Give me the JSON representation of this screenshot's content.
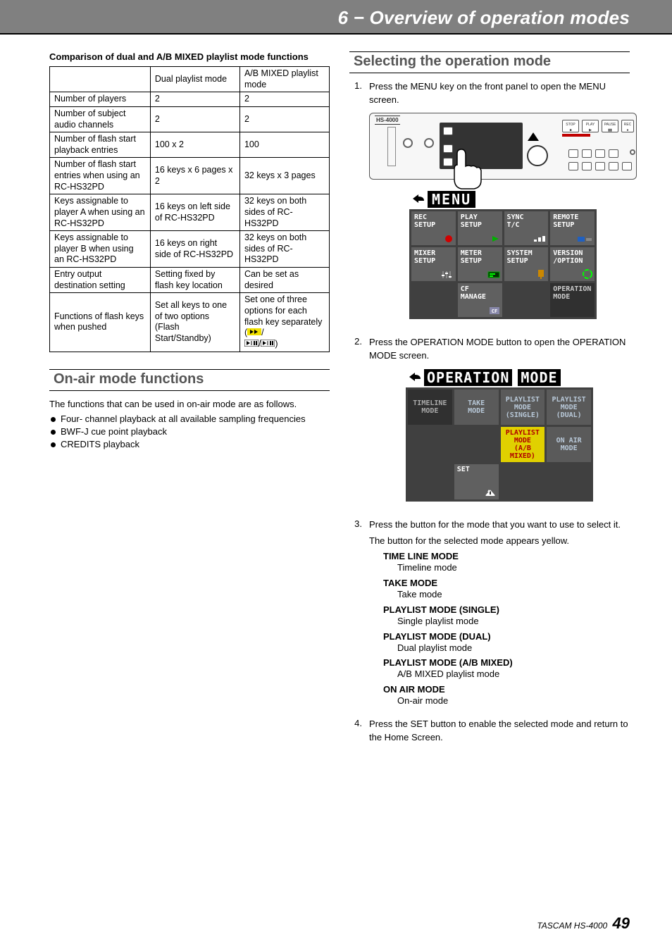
{
  "header": {
    "title": "6 − Overview of operation modes"
  },
  "left": {
    "comparison_title": "Comparison of dual and A/B MIXED playlist mode functions",
    "table": {
      "cols": [
        "",
        "Dual playlist mode",
        "A/B MIXED playlist mode"
      ],
      "rows": [
        [
          "Number of players",
          "2",
          "2"
        ],
        [
          "Number of subject audio channels",
          "2",
          "2"
        ],
        [
          "Number of flash start playback entries",
          "100 x 2",
          "100"
        ],
        [
          "Number of flash start entries when using an RC-HS32PD",
          "16 keys x 6 pages x 2",
          "32 keys x 3 pages"
        ],
        [
          "Keys assignable to player A when using an RC-HS32PD",
          "16 keys on left side of RC-HS32PD",
          "32 keys on both sides of RC-HS32PD"
        ],
        [
          "Keys assignable to player B when using an RC-HS32PD",
          "16 keys on right side of RC-HS32PD",
          "32 keys on both sides of RC-HS32PD"
        ],
        [
          "Entry output destination setting",
          "Setting fixed by flash key location",
          "Can be set as desired"
        ],
        [
          "Functions of flash keys when pushed",
          "Set all keys to one of two options (Flash Start/Standby)",
          "Set one of three options for each flash key separately"
        ]
      ]
    },
    "onair_title": "On-air mode functions",
    "onair_intro": "The functions that can be used in on-air mode are as follows.",
    "onair_items": [
      "Four- channel playback at all available sampling frequencies",
      "BWF-J cue point playback",
      "CREDITS playback"
    ]
  },
  "right": {
    "select_title": "Selecting the operation mode",
    "device_model": "HS-4000",
    "menu": {
      "title": "MENU",
      "cells": [
        {
          "l1": "REC",
          "l2": "SETUP",
          "icon": "rec"
        },
        {
          "l1": "PLAY",
          "l2": "SETUP",
          "icon": "play"
        },
        {
          "l1": "SYNC",
          "l2": "T/C",
          "icon": "sync"
        },
        {
          "l1": "REMOTE",
          "l2": "SETUP",
          "icon": "remote"
        },
        {
          "l1": "MIXER",
          "l2": "SETUP",
          "icon": "mixer"
        },
        {
          "l1": "METER",
          "l2": "SETUP",
          "icon": "meter"
        },
        {
          "l1": "SYSTEM",
          "l2": "SETUP",
          "icon": "system"
        },
        {
          "l1": "VERSION",
          "l2": "/OPTION",
          "icon": "version"
        },
        {
          "empty": true
        },
        {
          "l1": "CF",
          "l2": "MANAGE",
          "icon": "cf"
        },
        {
          "empty": true
        },
        {
          "l1": "OPERATION",
          "l2": "MODE",
          "dark": true
        }
      ]
    },
    "operation": {
      "title_a": "OPERATION",
      "title_b": "MODE",
      "cells": [
        {
          "l1": "TIMELINE",
          "l2": "MODE",
          "dark": true
        },
        {
          "l1": "TAKE",
          "l2": "MODE"
        },
        {
          "l1": "PLAYLIST",
          "l2": "MODE",
          "l3": "(SINGLE)"
        },
        {
          "l1": "PLAYLIST",
          "l2": "MODE",
          "l3": "(DUAL)"
        },
        {
          "empty": true
        },
        {
          "empty": true
        },
        {
          "l1": "PLAYLIST",
          "l2": "MODE",
          "l3": "(A/B MIXED)",
          "yellow": true
        },
        {
          "l1": "ON AIR",
          "l2": "MODE"
        }
      ],
      "set_label": "SET"
    },
    "steps": {
      "s1": "Press the MENU key on the front panel to open the MENU screen.",
      "s2": "Press the OPERATION MODE button to open the OPERATION MODE screen.",
      "s3a": "Press the button for the mode that you want to use to select it.",
      "s3b": "The button for the selected mode appears yellow.",
      "s4": "Press the SET button to enable the selected mode and return to the Home Screen."
    },
    "modes": [
      {
        "label": "TIME LINE MODE",
        "desc": "Timeline mode"
      },
      {
        "label": "TAKE MODE",
        "desc": "Take mode"
      },
      {
        "label": "PLAYLIST MODE (SINGLE)",
        "desc": "Single playlist mode"
      },
      {
        "label": "PLAYLIST MODE (DUAL)",
        "desc": "Dual playlist mode"
      },
      {
        "label": "PLAYLIST MODE (A/B MIXED)",
        "desc": "A/B MIXED playlist mode"
      },
      {
        "label": "ON AIR MODE",
        "desc": "On-air mode"
      }
    ]
  },
  "footer": {
    "brand": "TASCAM HS-4000",
    "page": "49"
  }
}
